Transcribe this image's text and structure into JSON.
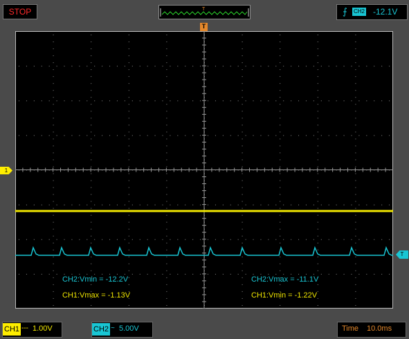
{
  "status": {
    "run_state": "STOP"
  },
  "trigger": {
    "marker": "T",
    "source": "CH2",
    "level": "-12.1V",
    "edge_icon": "rising-edge-icon"
  },
  "channel_markers": {
    "ch1": "1",
    "trigger_level": "T"
  },
  "measurements": {
    "ch2_vmin": "CH2:Vmin = -12.2V",
    "ch2_vmax": "CH2:Vmax = -11.1V",
    "ch1_vmax": "CH1:Vmax = -1.13V",
    "ch1_vmin": "CH1:Vmin = -1.22V"
  },
  "bottom": {
    "ch1_label": "CH1",
    "ch1_coupling": "---",
    "ch1_scale": "1.00V",
    "ch2_label": "CH2",
    "ch2_coupling": "~",
    "ch2_scale": "5.00V",
    "time_label": "Time",
    "time_scale": "10.0ms"
  },
  "colors": {
    "ch1": "#f0e600",
    "ch2": "#19c6d4",
    "stop": "#ff2a2a",
    "time": "#e4882b",
    "grid": "#8a8a8a"
  }
}
